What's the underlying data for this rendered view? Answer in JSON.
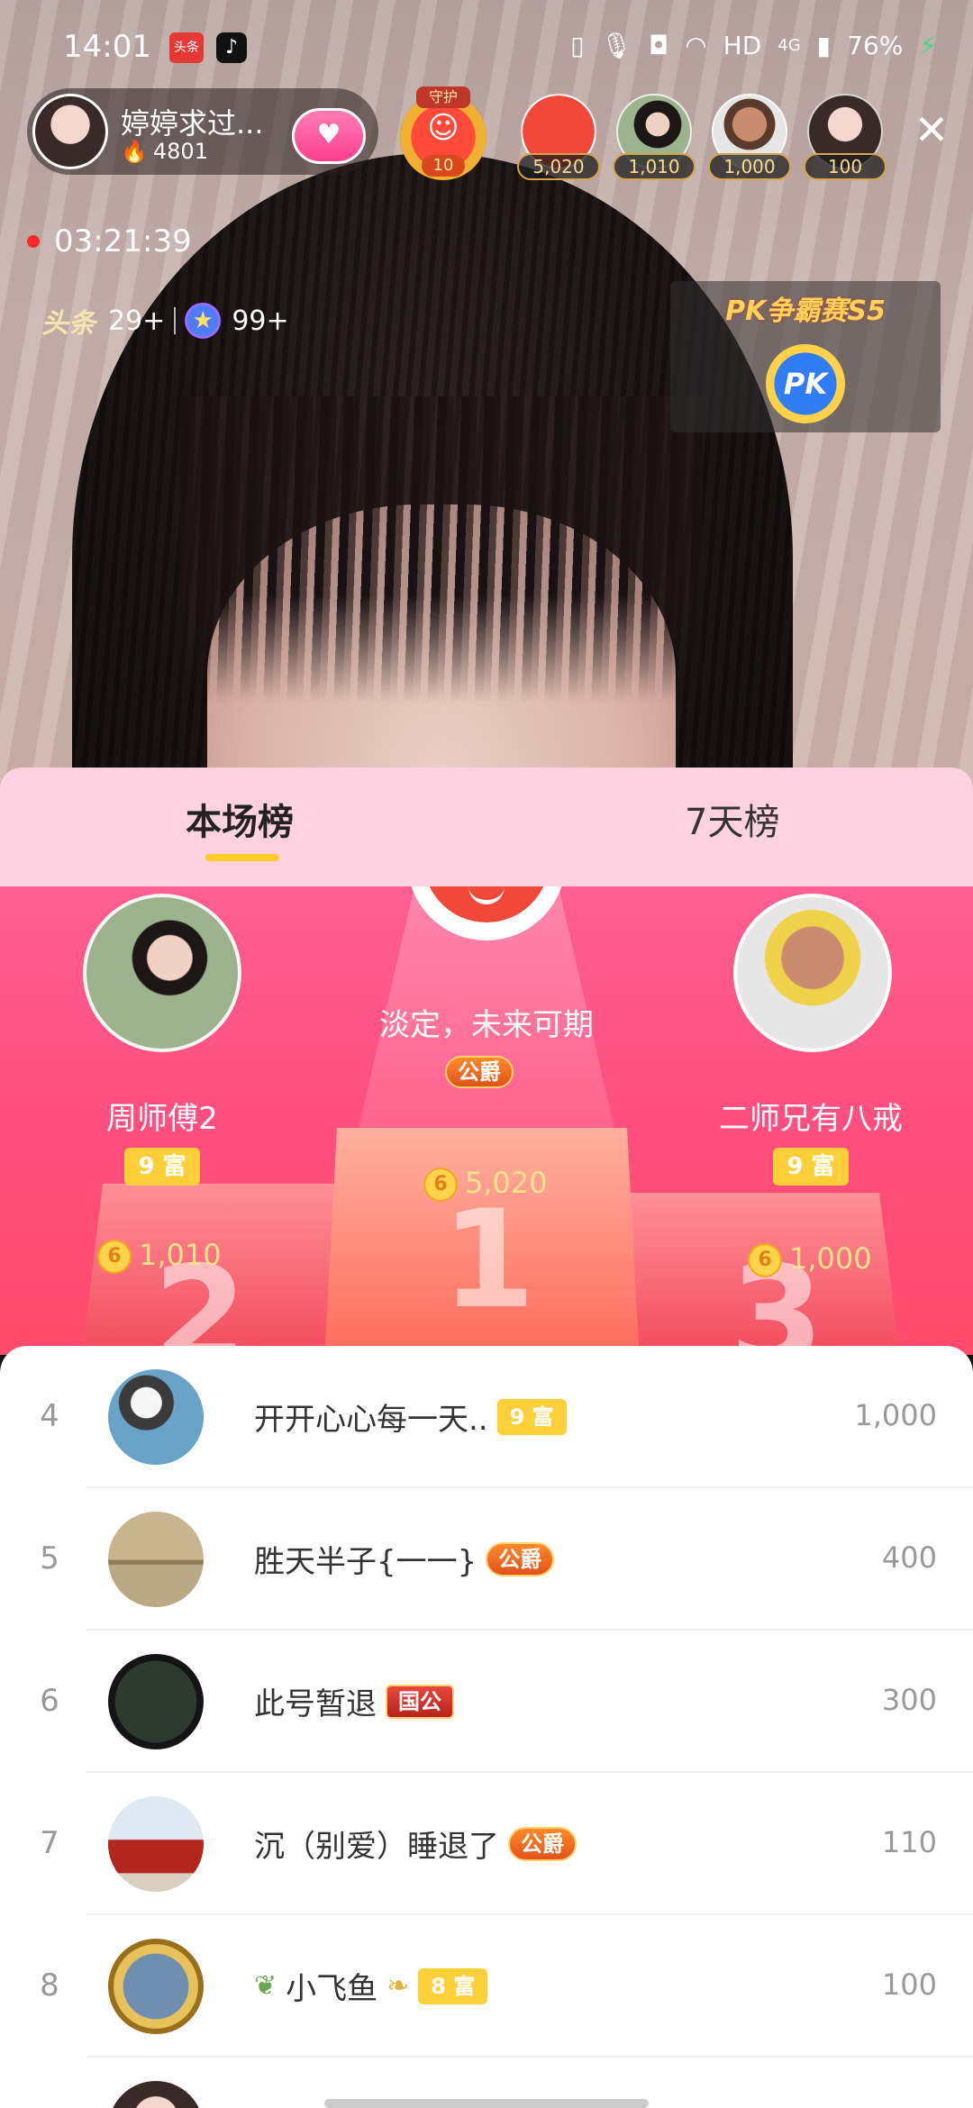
{
  "status_bar": {
    "time": "14:01",
    "app_icon_1": "头条",
    "app_icon_2": "tiktok-icon",
    "icons": [
      "vibrate-icon",
      "mic-icon",
      "camera-icon",
      "wifi-icon"
    ],
    "hd_label": "HD",
    "network_label": "4G",
    "battery": "76%"
  },
  "host": {
    "name": "婷婷求过...",
    "heat": "4801"
  },
  "guard": {
    "title": "守护",
    "count": "10"
  },
  "viewers": [
    {
      "score": "5,020"
    },
    {
      "score": "1,010"
    },
    {
      "score": "1,000"
    },
    {
      "score": "100"
    }
  ],
  "live": {
    "timer": "03:21:39",
    "toutiao_label": "头条",
    "toutiao_count": "29+",
    "star_count": "99+"
  },
  "pk": {
    "title": "PK争霸赛S5",
    "icon_label": "PK"
  },
  "tabs": [
    {
      "label": "本场榜",
      "active": true
    },
    {
      "label": "7天榜",
      "active": false
    }
  ],
  "podium": [
    {
      "rank": 1,
      "name": "淡定，未来可期",
      "badge": "公爵",
      "score": "5,020"
    },
    {
      "rank": 2,
      "name": "周师傅2",
      "badge": "9 富",
      "score": "1,010"
    },
    {
      "rank": 3,
      "name": "二师兄有八戒",
      "badge": "9 富",
      "score": "1,000"
    }
  ],
  "list": [
    {
      "rank": "4",
      "name": "开开心心每一天..",
      "badge": "9 富",
      "badge_type": "rich",
      "score": "1,000"
    },
    {
      "rank": "5",
      "name": "胜天半子{一一}",
      "badge": "公爵",
      "badge_type": "duke",
      "score": "400"
    },
    {
      "rank": "6",
      "name": "此号暂退",
      "badge": "国公",
      "badge_type": "guogong",
      "score": "300"
    },
    {
      "rank": "7",
      "name": "沉（别爱）睡退了",
      "badge": "公爵",
      "badge_type": "duke",
      "score": "110"
    },
    {
      "rank": "8",
      "name": "小飞鱼",
      "badge": "8 富",
      "badge_type": "rich",
      "score": "100"
    }
  ]
}
